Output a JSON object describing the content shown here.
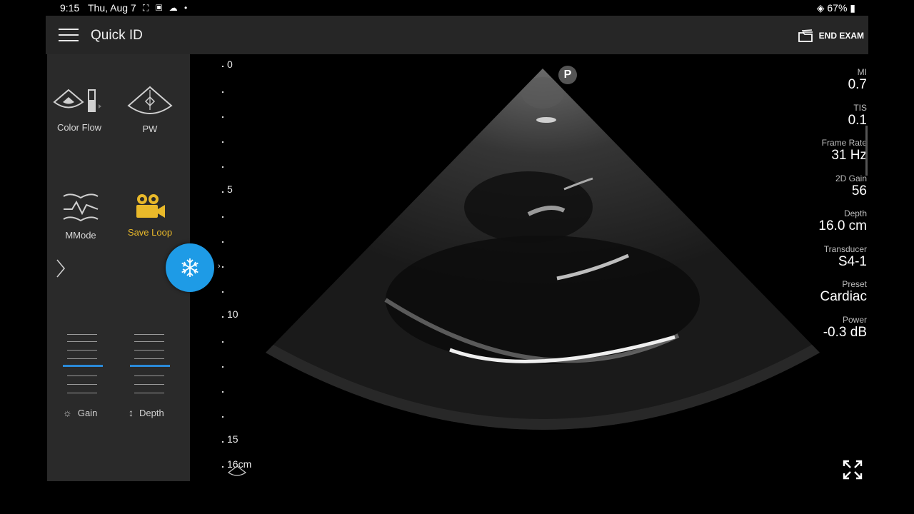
{
  "status": {
    "time": "9:15",
    "date": "Thu, Aug 7",
    "right": "67%"
  },
  "app": {
    "title": "Quick ID",
    "end_exam": "END EXAM"
  },
  "tools": {
    "color_flow": "Color Flow",
    "pw": "PW",
    "mmode": "MMode",
    "save_loop": "Save Loop"
  },
  "sliders": {
    "gain_label": "Gain",
    "depth_label": "Depth",
    "gain_level": 0.5,
    "depth_level": 0.5
  },
  "depth_scale": {
    "labels": [
      "0",
      "5",
      "10",
      "15"
    ],
    "unit": "16cm"
  },
  "probe_marker": "P",
  "params": [
    {
      "key": "MI",
      "value": "0.7"
    },
    {
      "key": "TIS",
      "value": "0.1"
    },
    {
      "key": "Frame Rate",
      "value": "31 Hz"
    },
    {
      "key": "2D Gain",
      "value": "56"
    },
    {
      "key": "Depth",
      "value": "16.0 cm"
    },
    {
      "key": "Transducer",
      "value": "S4-1"
    },
    {
      "key": "Preset",
      "value": "Cardiac"
    },
    {
      "key": "Power",
      "value": "-0.3 dB"
    }
  ],
  "colors": {
    "accent": "#1e9be6",
    "active_tool": "#e9b92a",
    "slider_thumb": "#2a8ad8",
    "panel": "#2a2a2a"
  }
}
